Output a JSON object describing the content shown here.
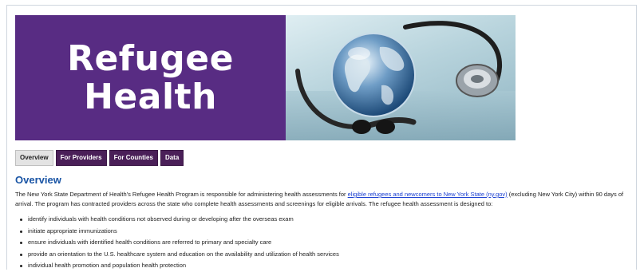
{
  "banner": {
    "title_line1": "Refugee",
    "title_line2": "Health"
  },
  "tabs": [
    {
      "label": "Overview",
      "active": true
    },
    {
      "label": "For Providers",
      "active": false
    },
    {
      "label": "For Counties",
      "active": false
    },
    {
      "label": "Data",
      "active": false
    }
  ],
  "overview": {
    "heading": "Overview",
    "intro_before_link": "The New York State Department of Health's Refugee Health Program is responsible for administering health assessments for ",
    "link_text": "eligible refugees and newcomers to New York State (ny.gov)",
    "intro_after_link": " (excluding New York City) within 90 days of arrival. The program has contracted providers across the state who complete health assessments and screenings for eligible arrivals. The refugee health assessment is designed to:",
    "bullets": [
      "identify individuals with health conditions not observed during or developing after the overseas exam",
      "initiate appropriate immunizations",
      "ensure individuals with identified health conditions are referred to primary and specialty care",
      "provide an orientation to the U.S. healthcare system and education on the availability and utilization of health services",
      "individual health promotion and population health protection"
    ]
  },
  "colors": {
    "banner_purple": "#582c83",
    "tab_purple": "#4a1f58",
    "heading_blue": "#1a55a5",
    "link_blue": "#1a3fd1"
  }
}
